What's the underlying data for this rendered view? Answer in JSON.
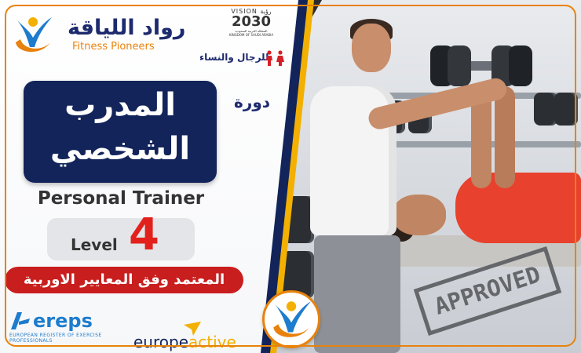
{
  "brand": {
    "name_ar": "رواد اللياقة",
    "name_en": "Fitness Pioneers"
  },
  "vision": {
    "line1": "VISION رؤية",
    "year": "2030",
    "line3": "المملكة العربية السعودية",
    "line4": "KINGDOM OF SAUDI ARABIA"
  },
  "audience_ar": "للرجال والنساء",
  "course_label_ar": "دورة",
  "title": {
    "line1_ar": "المدرب",
    "line2_ar": "الشخصي"
  },
  "subtitle_en": "Personal Trainer",
  "level": {
    "word": "Level",
    "number": "4"
  },
  "accreditation_ar": "المعتمد وفق المعايير الاوربية",
  "partners": {
    "ereps_name": "ereps",
    "ereps_sub": "EUROPEAN REGISTER OF EXERCISE PROFESSIONALS",
    "ea_part1": "europe",
    "ea_part2": "active"
  },
  "stamp_text": "APPROVED",
  "colors": {
    "navy": "#12245a",
    "orange": "#e8820c",
    "red": "#c91e1e",
    "yellow": "#f3b000",
    "ereps_blue": "#1d7ccd"
  }
}
